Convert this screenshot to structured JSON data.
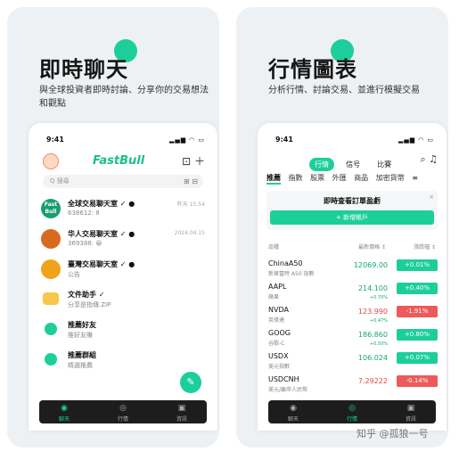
{
  "left_card": {
    "headline": "即時聊天",
    "subtitle": "與全球投資者即時討論、分享你的交易想法和觀點",
    "status_time": "9:41",
    "status_icons": "▂▄▆ ◠ ▭",
    "brand": "FastBull",
    "header_icons": "⊡ ＋",
    "search_placeholder": "Q 搜尋",
    "search_icons": "⊞ ⊟",
    "chats": [
      {
        "avatar_text": "Fast Bull",
        "avatar_color": "#1b9d6f",
        "name": "全球交易聊天室 ✓ ●",
        "sub": "638612: 8",
        "time": "昨天 15:54"
      },
      {
        "avatar_text": "",
        "avatar_color": "#d66a1f",
        "name": "华人交易聊天室 ✓ ●",
        "sub": "369388: 😀",
        "time": "2024.04.15"
      },
      {
        "avatar_text": "",
        "avatar_color": "#f0a21a",
        "name": "臺灣交易聊天室 ✓ ●",
        "sub": "公告",
        "time": ""
      },
      {
        "avatar_text": "",
        "avatar_color": "#f7c64a",
        "name": "文件助手 ✓",
        "sub": "分享是指傳.ZIP",
        "time": ""
      },
      {
        "avatar_text": "",
        "avatar_color": "#1ccf9a",
        "name": "推薦好友",
        "sub": "推好友賺",
        "time": ""
      },
      {
        "avatar_text": "",
        "avatar_color": "#1ccf9a",
        "name": "推薦群組",
        "sub": "精選推薦",
        "time": ""
      }
    ],
    "fab_icon": "✎",
    "tabs": [
      {
        "icon": "◉",
        "label": "聊天"
      },
      {
        "icon": "◎",
        "label": "行情"
      },
      {
        "icon": "▣",
        "label": "資訊"
      }
    ]
  },
  "right_card": {
    "headline": "行情圖表",
    "subtitle": "分析行情、討論交易、並進行模擬交易",
    "status_time": "9:41",
    "status_icons": "▂▄▆ ◠ ▭",
    "top_tabs": [
      "行情",
      "信号",
      "比賽"
    ],
    "header_icons": "⌕ ♫",
    "sub_tabs": [
      "推薦",
      "指數",
      "股票",
      "外匯",
      "商品",
      "加密貨幣",
      "≡"
    ],
    "promo": {
      "title": "即時查看訂單盈虧",
      "button": "+ 新增帳戶",
      "close": "×"
    },
    "columns": [
      "品種",
      "最新價格 ↕",
      "漲跌幅 ↕"
    ],
    "quotes": [
      {
        "symbol": "ChinaA50",
        "desc": "新華富時 A50 指數",
        "price": "12069.00",
        "change": "+0.01%",
        "change2": "",
        "dir": "up"
      },
      {
        "symbol": "AAPL",
        "desc": "蘋果",
        "price": "214.100",
        "change": "+0.40%",
        "change2": "+0.70%",
        "dir": "up"
      },
      {
        "symbol": "NVDA",
        "desc": "英偉達",
        "price": "123.990",
        "change": "-1.91%",
        "change2": "+0.47%",
        "dir": "down"
      },
      {
        "symbol": "GOOG",
        "desc": "谷歌-C",
        "price": "186.860",
        "change": "+0.80%",
        "change2": "+0.50%",
        "dir": "up"
      },
      {
        "symbol": "USDX",
        "desc": "美元指數",
        "price": "106.024",
        "change": "+0.07%",
        "change2": "",
        "dir": "up"
      },
      {
        "symbol": "USDCNH",
        "desc": "美元/離岸人民幣",
        "price": "7.29222",
        "change": "-0.14%",
        "change2": "",
        "dir": "down"
      }
    ],
    "tabs": [
      {
        "icon": "◉",
        "label": "聊天"
      },
      {
        "icon": "◎",
        "label": "行情"
      },
      {
        "icon": "▣",
        "label": "資訊"
      }
    ]
  },
  "watermark": "知乎 @孤狼一号"
}
